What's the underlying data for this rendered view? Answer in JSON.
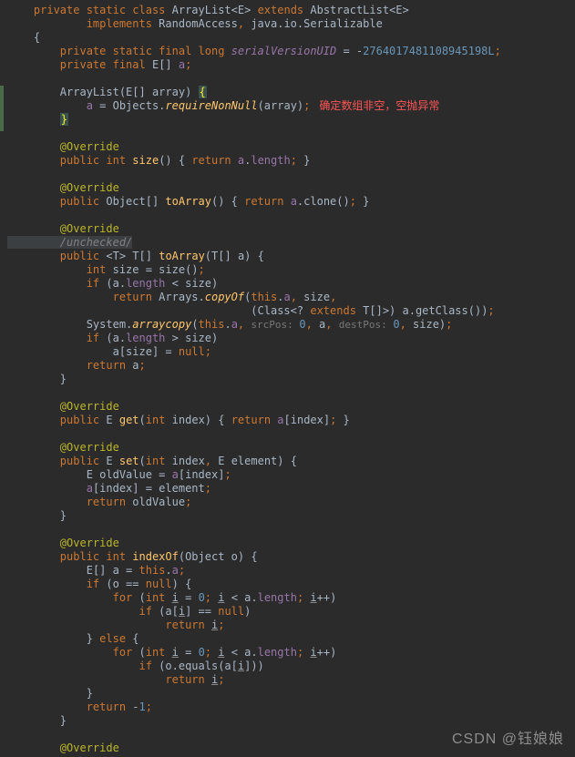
{
  "code": {
    "l1_a": "    private static class ",
    "l1_cls": "ArrayList",
    "l1_b": "<",
    "l1_E": "E",
    "l1_c": "> ",
    "l1_ext": "extends ",
    "l1_d": "AbstractList<",
    "l1_E2": "E",
    "l1_e": ">",
    "l2_a": "            implements ",
    "l2_b": "RandomAccess",
    "l2_c": ", ",
    "l2_d": "java.io.Serializable",
    "l3": "    {",
    "l4_a": "        private static final long ",
    "l4_svu": "serialVersionUID",
    "l4_b": " = -",
    "l4_num": "2764017481108945198L",
    "l4_c": ";",
    "l5_a": "        private final ",
    "l5_E": "E",
    "l5_b": "[] ",
    "l5_a2": "a",
    "l5_c": ";",
    "l7_a": "        ArrayList(",
    "l7_E": "E",
    "l7_b": "[] array) ",
    "l7_brace": "{",
    "l8_a": "            ",
    "l8_af": "a",
    "l8_b": " = Objects.",
    "l8_fn": "requireNonNull",
    "l8_c": "(array)",
    "l8_d": ";",
    "l8_comment": "   确定数组非空，空抛异常",
    "l9_brace": "        }",
    "l11_ann": "        @Override",
    "l12_a": "        public int ",
    "l12_fn": "size",
    "l12_b": "() { ",
    "l12_ret": "return ",
    "l12_af": "a",
    "l12_c": ".",
    "l12_len": "length",
    "l12_d": "; ",
    "l12_e": "}",
    "l14_ann": "        @Override",
    "l15_a": "        public ",
    "l15_b": "Object[] ",
    "l15_fn": "toArray",
    "l15_c": "() { ",
    "l15_ret": "return ",
    "l15_af": "a",
    "l15_d": ".clone()",
    "l15_e": "; ",
    "l15_f": "}",
    "l17_ann": "        @Override",
    "l18_cmt": "        /unchecked/",
    "l19_a": "        public ",
    "l19_t1": "<",
    "l19_T": "T",
    "l19_t2": "> ",
    "l19_T2": "T",
    "l19_b": "[] ",
    "l19_fn": "toArray",
    "l19_c": "(",
    "l19_T3": "T",
    "l19_d": "[] a) {",
    "l20_a": "            int ",
    "l20_b": "size = size()",
    "l20_c": ";",
    "l21_a": "            if ",
    "l21_b": "(a.",
    "l21_len": "length",
    "l21_c": " < size)",
    "l22_a": "                return ",
    "l22_b": "Arrays.",
    "l22_fn": "copyOf",
    "l22_c": "(",
    "l22_this": "this",
    "l22_d": ".",
    "l22_af": "a",
    "l22_e": ", ",
    "l22_f": "size",
    "l22_g": ",",
    "l23_a": "                                     (Class<? ",
    "l23_ext": "extends ",
    "l23_T": "T",
    "l23_b": "[]>) a.getClass())",
    "l23_c": ";",
    "l24_a": "            System.",
    "l24_fn": "arraycopy",
    "l24_b": "(",
    "l24_this": "this",
    "l24_c": ".",
    "l24_af": "a",
    "l24_d": ", ",
    "l24_h1": "srcPos: ",
    "l24_n1": "0",
    "l24_e": ", ",
    "l24_f": "a",
    "l24_g": ", ",
    "l24_h2": "destPos: ",
    "l24_n2": "0",
    "l24_h": ", ",
    "l24_i": "size)",
    "l24_j": ";",
    "l25_a": "            if ",
    "l25_b": "(a.",
    "l25_len": "length",
    "l25_c": " > size)",
    "l26_a": "                a[size] = ",
    "l26_null": "null",
    "l26_b": ";",
    "l27_a": "            return ",
    "l27_b": "a",
    "l27_c": ";",
    "l28": "        }",
    "l30_ann": "        @Override",
    "l31_a": "        public ",
    "l31_E": "E",
    "l31_b": " ",
    "l31_fn": "get",
    "l31_c": "(",
    "l31_int": "int ",
    "l31_d": "index) { ",
    "l31_ret": "return ",
    "l31_af": "a",
    "l31_e": "[index]",
    "l31_f": "; ",
    "l31_g": "}",
    "l33_ann": "        @Override",
    "l34_a": "        public ",
    "l34_E": "E",
    "l34_b": " ",
    "l34_fn": "set",
    "l34_c": "(",
    "l34_int": "int ",
    "l34_d": "index",
    "l34_e": ", ",
    "l34_E2": "E",
    "l34_f": " element) {",
    "l35_a": "            ",
    "l35_E": "E",
    "l35_b": " oldValue = ",
    "l35_af": "a",
    "l35_c": "[index]",
    "l35_d": ";",
    "l36_a": "            ",
    "l36_af": "a",
    "l36_b": "[index] = element",
    "l36_c": ";",
    "l37_a": "            return ",
    "l37_b": "oldValue",
    "l37_c": ";",
    "l38": "        }",
    "l40_ann": "        @Override",
    "l41_a": "        public int ",
    "l41_fn": "indexOf",
    "l41_b": "(Object o) {",
    "l42_a": "            ",
    "l42_E": "E",
    "l42_b": "[] a = ",
    "l42_this": "this",
    "l42_c": ".",
    "l42_af": "a",
    "l42_d": ";",
    "l43_a": "            if ",
    "l43_b": "(o == ",
    "l43_null": "null",
    "l43_c": ") {",
    "l44_a": "                for ",
    "l44_b": "(",
    "l44_int": "int ",
    "l44_i": "i",
    "l44_c": " = ",
    "l44_n0": "0",
    "l44_d": "; ",
    "l44_i2": "i",
    "l44_e": " < a.",
    "l44_len": "length",
    "l44_f": "; ",
    "l44_i3": "i",
    "l44_g": "++)",
    "l45_a": "                    if ",
    "l45_b": "(a[",
    "l45_i": "i",
    "l45_c": "] == ",
    "l45_null": "null",
    "l45_d": ")",
    "l46_a": "                        return ",
    "l46_i": "i",
    "l46_b": ";",
    "l47_a": "            } ",
    "l47_else": "else ",
    "l47_b": "{",
    "l48_a": "                for ",
    "l48_b": "(",
    "l48_int": "int ",
    "l48_i": "i",
    "l48_c": " = ",
    "l48_n0": "0",
    "l48_d": "; ",
    "l48_i2": "i",
    "l48_e": " < a.",
    "l48_len": "length",
    "l48_f": "; ",
    "l48_i3": "i",
    "l48_g": "++)",
    "l49_a": "                    if ",
    "l49_b": "(o.equals(a[",
    "l49_i": "i",
    "l49_c": "]))",
    "l50_a": "                        return ",
    "l50_i": "i",
    "l50_b": ";",
    "l51": "            }",
    "l52_a": "            return ",
    "l52_b": "-",
    "l52_n1": "1",
    "l52_c": ";",
    "l53": "        }",
    "l55_ann": "        @Override"
  },
  "watermark": "CSDN @钰娘娘"
}
